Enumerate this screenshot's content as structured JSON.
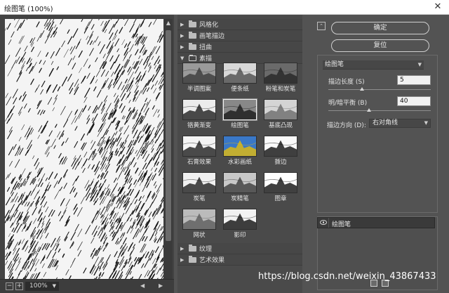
{
  "window": {
    "title": "绘图笔 (100%)",
    "close_glyph": "✕"
  },
  "preview": {
    "zoom_out": "−",
    "zoom_in": "+",
    "zoom_level": "100%"
  },
  "gallery": {
    "categories_top": [
      {
        "label": "风格化",
        "open": false
      },
      {
        "label": "画笔描边",
        "open": false
      },
      {
        "label": "扭曲",
        "open": false
      },
      {
        "label": "素描",
        "open": true
      }
    ],
    "filters": [
      {
        "label": "半调图案",
        "selected": false
      },
      {
        "label": "便条纸",
        "selected": false
      },
      {
        "label": "粉笔和炭笔",
        "selected": false
      },
      {
        "label": "铬黄渐变",
        "selected": false
      },
      {
        "label": "绘图笔",
        "selected": true
      },
      {
        "label": "基底凸现",
        "selected": false
      },
      {
        "label": "石膏效果",
        "selected": false
      },
      {
        "label": "水彩画纸",
        "selected": false
      },
      {
        "label": "撕边",
        "selected": false
      },
      {
        "label": "炭笔",
        "selected": false
      },
      {
        "label": "炭精笔",
        "selected": false
      },
      {
        "label": "图章",
        "selected": false
      },
      {
        "label": "网状",
        "selected": false
      },
      {
        "label": "影印",
        "selected": false
      }
    ],
    "categories_bottom": [
      {
        "label": "纹理",
        "open": false
      },
      {
        "label": "艺术效果",
        "open": false
      }
    ]
  },
  "controls": {
    "ok_label": "确定",
    "reset_label": "复位",
    "filter_select": "绘图笔",
    "stroke_length_label": "描边长度 (S)",
    "stroke_length_value": "5",
    "stroke_length_fraction": 0.33,
    "balance_label": "明/暗平衡 (B)",
    "balance_value": "40",
    "balance_fraction": 0.4,
    "direction_label": "描边方向 (D):",
    "direction_value": "右对角线"
  },
  "layers": {
    "items": [
      {
        "name": "绘图笔"
      }
    ]
  },
  "watermark": "https://blog.csdn.net/weixin_43867433"
}
